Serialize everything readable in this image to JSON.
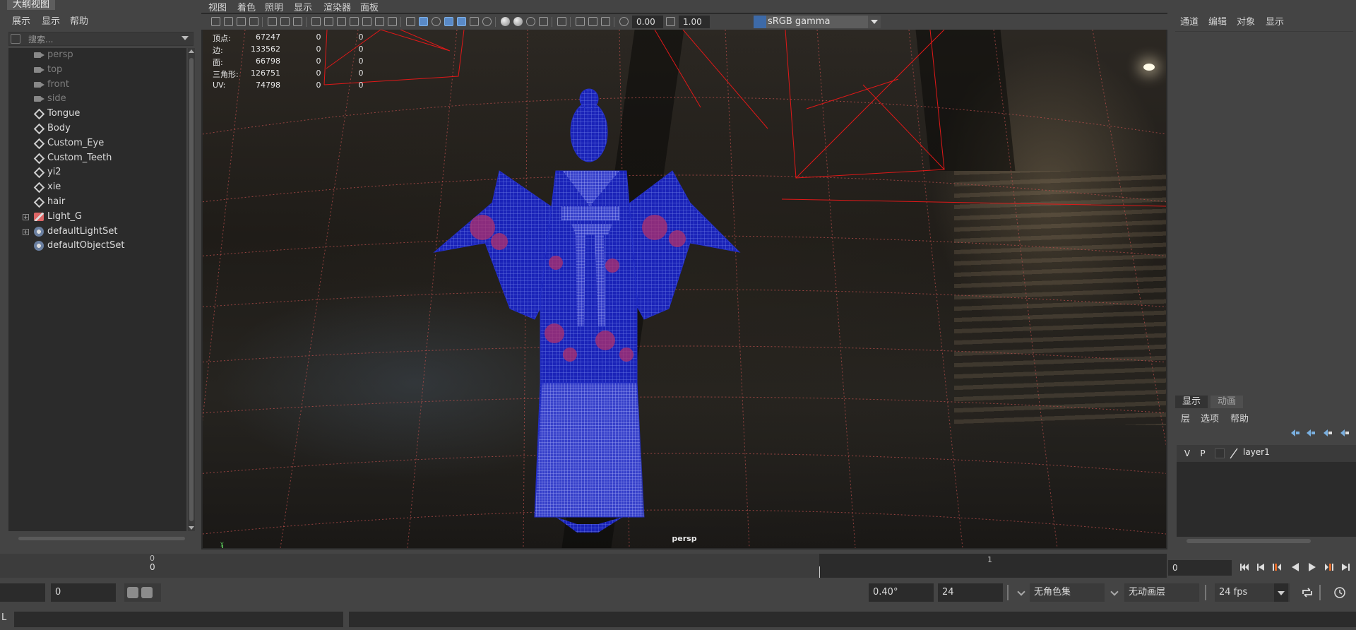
{
  "outliner": {
    "tab_title": "大纲视图",
    "menu": [
      "展示",
      "显示",
      "帮助"
    ],
    "search_placeholder": "搜索...",
    "nodes": [
      {
        "label": "persp",
        "type": "camera",
        "dim": true,
        "expand": false
      },
      {
        "label": "top",
        "type": "camera",
        "dim": true,
        "expand": false
      },
      {
        "label": "front",
        "type": "camera",
        "dim": true,
        "expand": false
      },
      {
        "label": "side",
        "type": "camera",
        "dim": true,
        "expand": false
      },
      {
        "label": "Tongue",
        "type": "mesh",
        "dim": false,
        "expand": false
      },
      {
        "label": "Body",
        "type": "mesh",
        "dim": false,
        "expand": false
      },
      {
        "label": "Custom_Eye",
        "type": "mesh",
        "dim": false,
        "expand": false
      },
      {
        "label": "Custom_Teeth",
        "type": "mesh",
        "dim": false,
        "expand": false
      },
      {
        "label": "yi2",
        "type": "mesh",
        "dim": false,
        "expand": false
      },
      {
        "label": "xie",
        "type": "mesh",
        "dim": false,
        "expand": false
      },
      {
        "label": "hair",
        "type": "mesh",
        "dim": false,
        "expand": false
      },
      {
        "label": "Light_G",
        "type": "light",
        "dim": false,
        "expand": true
      },
      {
        "label": "defaultLightSet",
        "type": "set",
        "dim": false,
        "expand": true
      },
      {
        "label": "defaultObjectSet",
        "type": "set",
        "dim": false,
        "expand": false
      }
    ]
  },
  "viewport": {
    "menu": [
      "视图",
      "着色",
      "照明",
      "显示",
      "渲染器",
      "面板"
    ],
    "exposure": "0.00",
    "gamma": "1.00",
    "color_space": "sRGB gamma",
    "camera_label": "persp",
    "hud": [
      {
        "key": "顶点:",
        "v1": "67247",
        "v2": "0",
        "v3": "0"
      },
      {
        "key": "边:",
        "v1": "133562",
        "v2": "0",
        "v3": "0"
      },
      {
        "key": "面:",
        "v1": "66798",
        "v2": "0",
        "v3": "0"
      },
      {
        "key": "三角形:",
        "v1": "126751",
        "v2": "0",
        "v3": "0"
      },
      {
        "key": "UV:",
        "v1": "74798",
        "v2": "0",
        "v3": "0"
      }
    ],
    "wire_color": "#1a23b8",
    "grid_color": "#c0504d",
    "camera_frustum_color": "#e01818"
  },
  "channel_box": {
    "menu": [
      "通道",
      "编辑",
      "对象",
      "显示"
    ]
  },
  "layer_editor": {
    "tabs": [
      "显示",
      "动画"
    ],
    "menu": [
      "层",
      "选项",
      "帮助"
    ],
    "layers": [
      {
        "visible": "V",
        "playback": "P",
        "name": "layer1"
      }
    ]
  },
  "time_slider": {
    "ticks": [
      {
        "label": "0"
      },
      {
        "label": "1"
      }
    ],
    "start_tick": "0",
    "current_frame": "0"
  },
  "range_slider": {
    "start": "",
    "start_anim": "0",
    "focal": "0.40°",
    "end": "24",
    "char_set": "无角色集",
    "anim_layer": "无动画层",
    "fps": "24 fps"
  },
  "command_line": {
    "language": "L"
  }
}
